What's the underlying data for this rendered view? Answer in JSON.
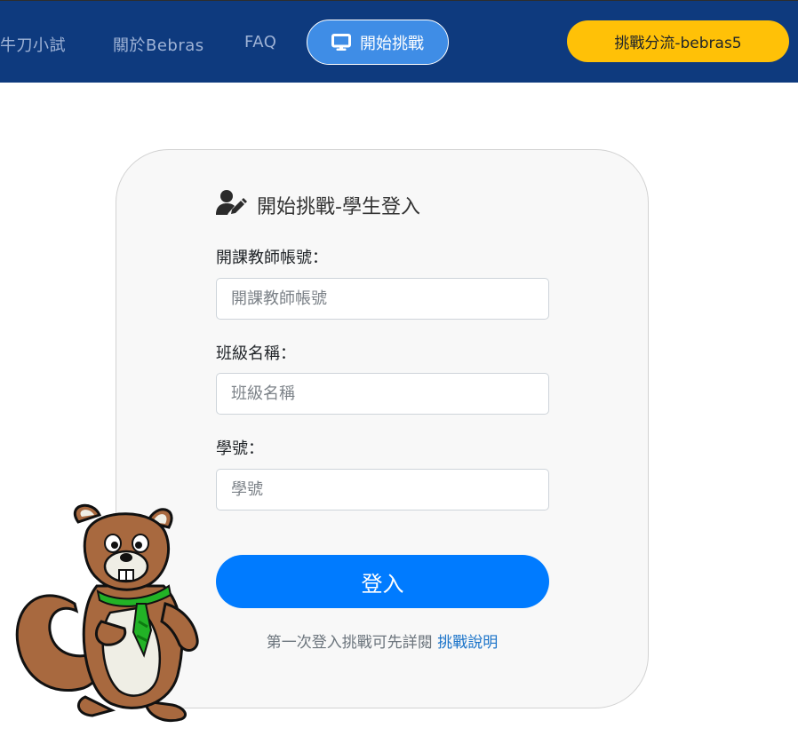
{
  "navbar": {
    "links": [
      {
        "label": "牛刀小試"
      },
      {
        "label": "關於Bebras"
      },
      {
        "label": "FAQ"
      }
    ],
    "active": {
      "label": "開始挑戰",
      "icon": "monitor-icon"
    },
    "challenge_pill": {
      "label": "挑戰分流-bebras5"
    }
  },
  "login_card": {
    "title": "開始挑戰-學生登入",
    "title_icon": "user-edit-icon",
    "fields": [
      {
        "label": "開課教師帳號：",
        "placeholder": "開課教師帳號",
        "value": ""
      },
      {
        "label": "班級名稱：",
        "placeholder": "班級名稱",
        "value": ""
      },
      {
        "label": "學號：",
        "placeholder": "學號",
        "value": ""
      }
    ],
    "submit_label": "登入",
    "hint_text": "第一次登入挑戰可先詳閱",
    "hint_link": "挑戰說明"
  },
  "colors": {
    "navbar_bg": "#0e3a7e",
    "active_pill": "#3f8de6",
    "challenge_pill": "#ffc107",
    "primary_button": "#007bff"
  }
}
